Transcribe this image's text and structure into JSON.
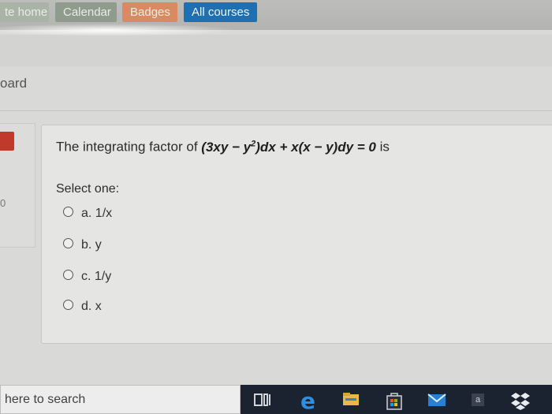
{
  "nav": {
    "items": [
      {
        "label": "te home",
        "bg": "#a9b4a6"
      },
      {
        "label": "Calendar",
        "bg": "#8f9b8c"
      },
      {
        "label": "Badges",
        "bg": "#d98a62"
      },
      {
        "label": "All courses",
        "bg": "#1f6fb3"
      }
    ]
  },
  "page": {
    "breadcrumb": "oard"
  },
  "sidebar": {
    "digit": "0"
  },
  "question": {
    "prefix": "The integrating factor of ",
    "formula_a": "(3xy − y",
    "formula_sup": "2",
    "formula_b": ")dx + x(x − y)dy = 0",
    "suffix": " is",
    "select_label": "Select one:",
    "options": [
      {
        "label": "a. 1/x"
      },
      {
        "label": "b. y"
      },
      {
        "label": "c. 1/y"
      },
      {
        "label": "d. x"
      }
    ]
  },
  "taskbar": {
    "search_text": "here to search",
    "icons": [
      "task-view-icon",
      "edge-icon",
      "file-explorer-icon",
      "store-icon",
      "mail-icon",
      "app-icon",
      "dropbox-icon"
    ],
    "app_icon_letter": "a"
  }
}
